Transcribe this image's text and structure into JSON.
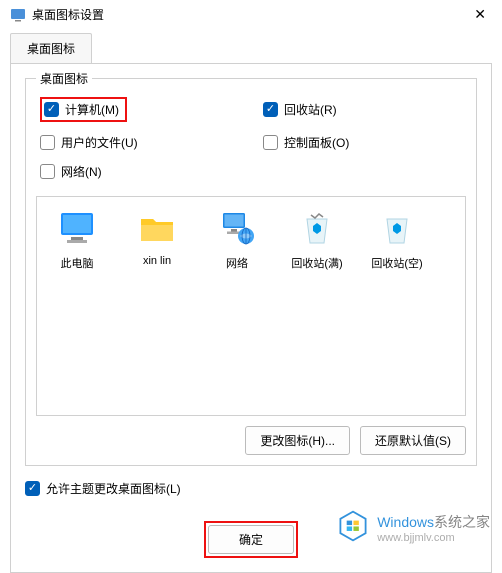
{
  "window": {
    "title": "桌面图标设置",
    "close": "✕"
  },
  "tab": {
    "label": "桌面图标"
  },
  "fieldset": {
    "legend": "桌面图标"
  },
  "checkboxes": {
    "computer": {
      "label": "计算机(M)",
      "checked": true
    },
    "recycle": {
      "label": "回收站(R)",
      "checked": true
    },
    "userfiles": {
      "label": "用户的文件(U)",
      "checked": false
    },
    "controlpanel": {
      "label": "控制面板(O)",
      "checked": false
    },
    "network": {
      "label": "网络(N)",
      "checked": false
    }
  },
  "icons": {
    "thispc": "此电脑",
    "xinlin": "xin lin",
    "network": "网络",
    "recyclefull": "回收站(满)",
    "recycleempty": "回收站(空)"
  },
  "buttons": {
    "changeicon": "更改图标(H)...",
    "restoredefault": "还原默认值(S)",
    "ok": "确定"
  },
  "themecb": {
    "label": "允许主题更改桌面图标(L)",
    "checked": true
  },
  "watermark": {
    "brand_prefix": "Windows",
    "brand_suffix": "系统之家",
    "url": "www.bjjmlv.com"
  }
}
